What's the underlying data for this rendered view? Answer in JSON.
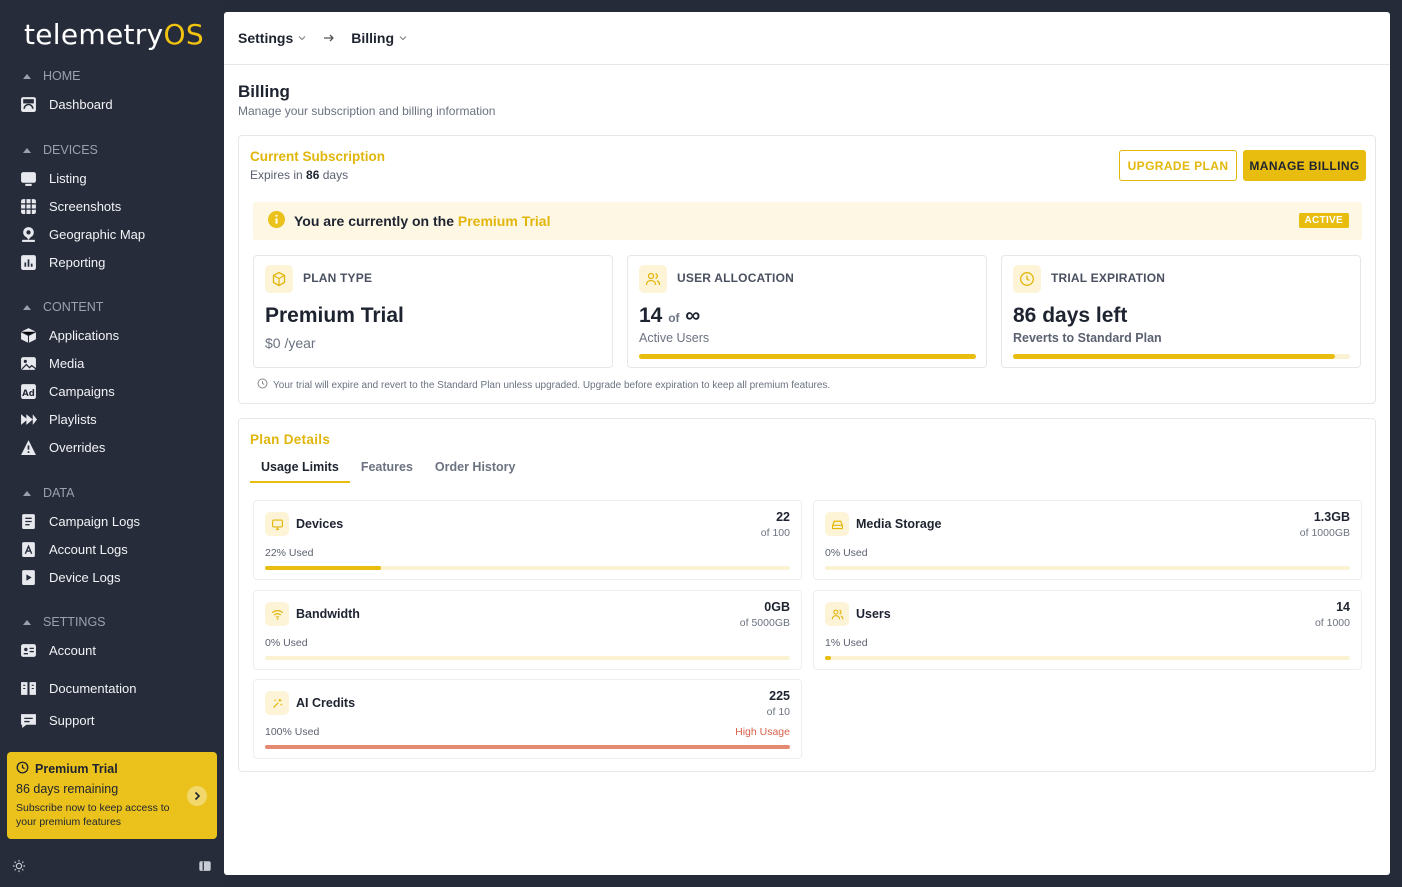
{
  "app": {
    "logo_main": "telemetry",
    "logo_suffix": "OS"
  },
  "sidebar": {
    "sections": [
      {
        "label": "HOME",
        "items": [
          {
            "label": "Dashboard",
            "icon": "dashboard-icon"
          }
        ]
      },
      {
        "label": "DEVICES",
        "items": [
          {
            "label": "Listing",
            "icon": "monitor-icon"
          },
          {
            "label": "Screenshots",
            "icon": "grid-icon"
          },
          {
            "label": "Geographic Map",
            "icon": "map-pin-icon"
          },
          {
            "label": "Reporting",
            "icon": "bar-chart-icon"
          }
        ]
      },
      {
        "label": "CONTENT",
        "items": [
          {
            "label": "Applications",
            "icon": "box-icon"
          },
          {
            "label": "Media",
            "icon": "image-icon"
          },
          {
            "label": "Campaigns",
            "icon": "ad-icon"
          },
          {
            "label": "Playlists",
            "icon": "playlist-icon"
          },
          {
            "label": "Overrides",
            "icon": "warning-icon"
          }
        ]
      },
      {
        "label": "DATA",
        "items": [
          {
            "label": "Campaign Logs",
            "icon": "document-icon"
          },
          {
            "label": "Account Logs",
            "icon": "account-doc-icon"
          },
          {
            "label": "Device Logs",
            "icon": "play-doc-icon"
          }
        ]
      },
      {
        "label": "SETTINGS",
        "items": [
          {
            "label": "Account",
            "icon": "id-card-icon"
          }
        ]
      }
    ],
    "documentation": "Documentation",
    "support": "Support",
    "promo": {
      "title": "Premium Trial",
      "days": "86 days remaining",
      "subtitle": "Subscribe now to keep access to your premium features"
    }
  },
  "breadcrumb": {
    "settings": "Settings",
    "billing": "Billing"
  },
  "page": {
    "title": "Billing",
    "subtitle": "Manage your subscription and billing information"
  },
  "subscription": {
    "title": "Current Subscription",
    "expires_prefix": "Expires in",
    "expires_days": "86",
    "expires_suffix": "days",
    "upgrade_button": "UPGRADE PLAN",
    "manage_button": "MANAGE BILLING",
    "banner_prefix": "You are currently on the",
    "banner_plan": "Premium Trial",
    "banner_badge": "ACTIVE",
    "stats": [
      {
        "label": "PLAN TYPE",
        "big": "Premium Trial",
        "sub": "$0 /year"
      },
      {
        "label": "USER ALLOCATION",
        "big_num": "14",
        "big_of": "of",
        "big_inf": "∞",
        "sub": "Active Users",
        "progress": 1.0
      },
      {
        "label": "TRIAL EXPIRATION",
        "big": "86 days left",
        "sub": "Reverts to Standard Plan",
        "progress": 0.955
      }
    ],
    "note": "Your trial will expire and revert to the Standard Plan unless upgraded. Upgrade before expiration to keep all premium features."
  },
  "plan_details": {
    "title": "Plan Details",
    "tabs": [
      "Usage Limits",
      "Features",
      "Order History"
    ],
    "active_tab": "Usage Limits",
    "usage": [
      {
        "name": "Devices",
        "value": "22",
        "of": "of 100",
        "pct_label": "22% Used",
        "fraction": 0.22,
        "icon": "device-icon"
      },
      {
        "name": "Media Storage",
        "value": "1.3GB",
        "of": "of 1000GB",
        "pct_label": "0% Used",
        "fraction": 0.0,
        "icon": "storage-icon"
      },
      {
        "name": "Bandwidth",
        "value": "0GB",
        "of": "of 5000GB",
        "pct_label": "0% Used",
        "fraction": 0.0,
        "icon": "wifi-icon"
      },
      {
        "name": "Users",
        "value": "14",
        "of": "of 1000",
        "pct_label": "1% Used",
        "fraction": 0.01,
        "icon": "users-icon"
      },
      {
        "name": "AI Credits",
        "value": "225",
        "of": "of 10",
        "pct_label": "100% Used",
        "fraction": 1.0,
        "warning": "High Usage",
        "icon": "sparkle-icon"
      }
    ]
  },
  "colors": {
    "accent": "#e8bd10",
    "sidebar_bg": "#262c3a",
    "warning": "#d9614a"
  }
}
